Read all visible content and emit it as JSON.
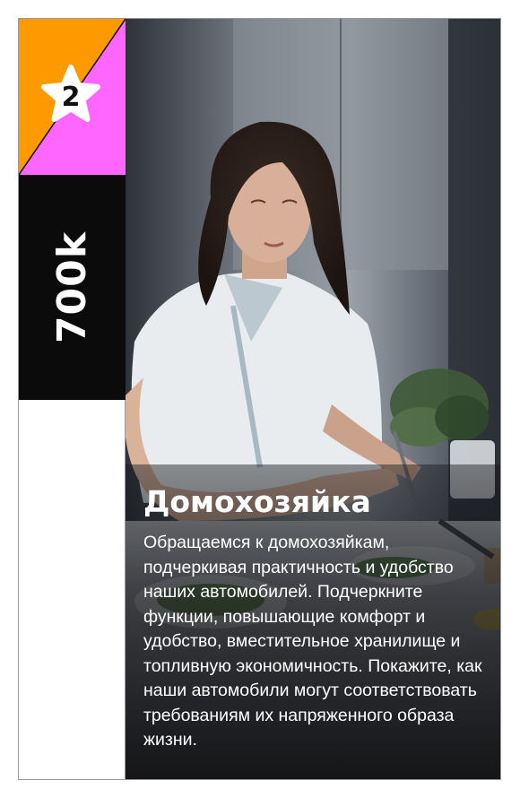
{
  "card": {
    "rank": "2",
    "value": "700k",
    "title": "Домохозяйка",
    "description": "Обращаемся к домохозяйкам, подчеркивая практичность и удобство наших автомобилей. Подчеркните функции, повышающие комфорт и удобство, вместительное хранилище и топливную экономичность. Покажите, как наши автомобили могут соответствовать требованиям их напряженного образа жизни."
  },
  "colors": {
    "corner_orange": "#ff9900",
    "corner_pink": "#ff66ff",
    "value_block": "#0b0b0b",
    "star": "#ffffff"
  },
  "icons": {
    "rank": "star-icon"
  }
}
